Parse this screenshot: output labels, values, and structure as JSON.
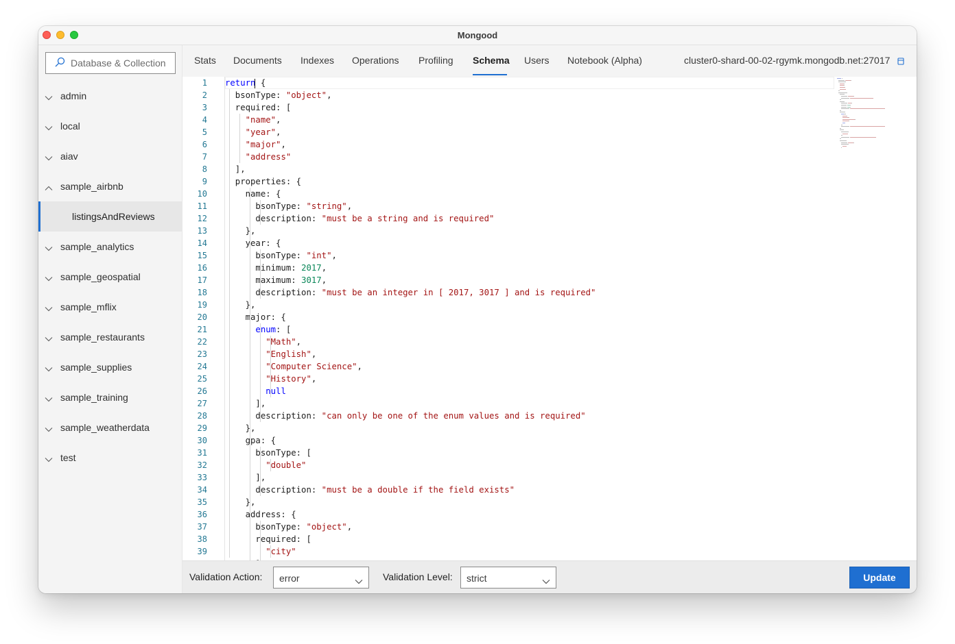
{
  "window": {
    "title": "Mongood"
  },
  "sidebar": {
    "button_label": "Database & Collection",
    "databases": [
      {
        "name": "admin",
        "expanded": false
      },
      {
        "name": "local",
        "expanded": false
      },
      {
        "name": "aiav",
        "expanded": false
      },
      {
        "name": "sample_airbnb",
        "expanded": true,
        "collections": [
          "listingsAndReviews"
        ]
      },
      {
        "name": "sample_analytics",
        "expanded": false
      },
      {
        "name": "sample_geospatial",
        "expanded": false
      },
      {
        "name": "sample_mflix",
        "expanded": false
      },
      {
        "name": "sample_restaurants",
        "expanded": false
      },
      {
        "name": "sample_supplies",
        "expanded": false
      },
      {
        "name": "sample_training",
        "expanded": false
      },
      {
        "name": "sample_weatherdata",
        "expanded": false
      },
      {
        "name": "test",
        "expanded": false
      }
    ],
    "selected_collection": "listingsAndReviews"
  },
  "tabs": [
    "Stats",
    "Documents",
    "Indexes",
    "Operations",
    "Profiling",
    "Schema",
    "Users",
    "Notebook (Alpha)"
  ],
  "active_tab": "Schema",
  "server": "cluster0-shard-00-02-rgymk.mongodb.net:27017",
  "editor": {
    "lines": [
      [
        [
          "kw",
          "return"
        ],
        [
          "p",
          " {"
        ]
      ],
      [
        [
          "p",
          "  bsonType: "
        ],
        [
          "s",
          "\"object\""
        ],
        [
          "p",
          ","
        ]
      ],
      [
        [
          "p",
          "  required: ["
        ]
      ],
      [
        [
          "p",
          "    "
        ],
        [
          "s",
          "\"name\""
        ],
        [
          "p",
          ","
        ]
      ],
      [
        [
          "p",
          "    "
        ],
        [
          "s",
          "\"year\""
        ],
        [
          "p",
          ","
        ]
      ],
      [
        [
          "p",
          "    "
        ],
        [
          "s",
          "\"major\""
        ],
        [
          "p",
          ","
        ]
      ],
      [
        [
          "p",
          "    "
        ],
        [
          "s",
          "\"address\""
        ]
      ],
      [
        [
          "p",
          "  ],"
        ]
      ],
      [
        [
          "p",
          "  properties: {"
        ]
      ],
      [
        [
          "p",
          "    name: {"
        ]
      ],
      [
        [
          "p",
          "      bsonType: "
        ],
        [
          "s",
          "\"string\""
        ],
        [
          "p",
          ","
        ]
      ],
      [
        [
          "p",
          "      description: "
        ],
        [
          "s",
          "\"must be a string and is required\""
        ]
      ],
      [
        [
          "p",
          "    },"
        ]
      ],
      [
        [
          "p",
          "    year: {"
        ]
      ],
      [
        [
          "p",
          "      bsonType: "
        ],
        [
          "s",
          "\"int\""
        ],
        [
          "p",
          ","
        ]
      ],
      [
        [
          "p",
          "      minimum: "
        ],
        [
          "n",
          "2017"
        ],
        [
          "p",
          ","
        ]
      ],
      [
        [
          "p",
          "      maximum: "
        ],
        [
          "n",
          "3017"
        ],
        [
          "p",
          ","
        ]
      ],
      [
        [
          "p",
          "      description: "
        ],
        [
          "s",
          "\"must be an integer in [ 2017, 3017 ] and is required\""
        ]
      ],
      [
        [
          "p",
          "    },"
        ]
      ],
      [
        [
          "p",
          "    major: {"
        ]
      ],
      [
        [
          "p",
          "      "
        ],
        [
          "kw",
          "enum"
        ],
        [
          "p",
          ": ["
        ]
      ],
      [
        [
          "p",
          "        "
        ],
        [
          "s",
          "\"Math\""
        ],
        [
          "p",
          ","
        ]
      ],
      [
        [
          "p",
          "        "
        ],
        [
          "s",
          "\"English\""
        ],
        [
          "p",
          ","
        ]
      ],
      [
        [
          "p",
          "        "
        ],
        [
          "s",
          "\"Computer Science\""
        ],
        [
          "p",
          ","
        ]
      ],
      [
        [
          "p",
          "        "
        ],
        [
          "s",
          "\"History\""
        ],
        [
          "p",
          ","
        ]
      ],
      [
        [
          "p",
          "        "
        ],
        [
          "kw",
          "null"
        ]
      ],
      [
        [
          "p",
          "      ],"
        ]
      ],
      [
        [
          "p",
          "      description: "
        ],
        [
          "s",
          "\"can only be one of the enum values and is required\""
        ]
      ],
      [
        [
          "p",
          "    },"
        ]
      ],
      [
        [
          "p",
          "    gpa: {"
        ]
      ],
      [
        [
          "p",
          "      bsonType: ["
        ]
      ],
      [
        [
          "p",
          "        "
        ],
        [
          "s",
          "\"double\""
        ]
      ],
      [
        [
          "p",
          "      ],"
        ]
      ],
      [
        [
          "p",
          "      description: "
        ],
        [
          "s",
          "\"must be a double if the field exists\""
        ]
      ],
      [
        [
          "p",
          "    },"
        ]
      ],
      [
        [
          "p",
          "    address: {"
        ]
      ],
      [
        [
          "p",
          "      bsonType: "
        ],
        [
          "s",
          "\"object\""
        ],
        [
          "p",
          ","
        ]
      ],
      [
        [
          "p",
          "      required: ["
        ]
      ],
      [
        [
          "p",
          "        "
        ],
        [
          "s",
          "\"city\""
        ]
      ],
      [
        [
          "p",
          "      ]"
        ]
      ]
    ],
    "colors": {
      "keyword": "#0000ff",
      "string": "#a31515",
      "number": "#098658",
      "line_number": "#237893"
    }
  },
  "footer": {
    "validation_action_label": "Validation Action:",
    "validation_action_value": "error",
    "validation_level_label": "Validation Level:",
    "validation_level_value": "strict",
    "update_label": "Update"
  },
  "colors": {
    "accent": "#1f6fd1"
  }
}
